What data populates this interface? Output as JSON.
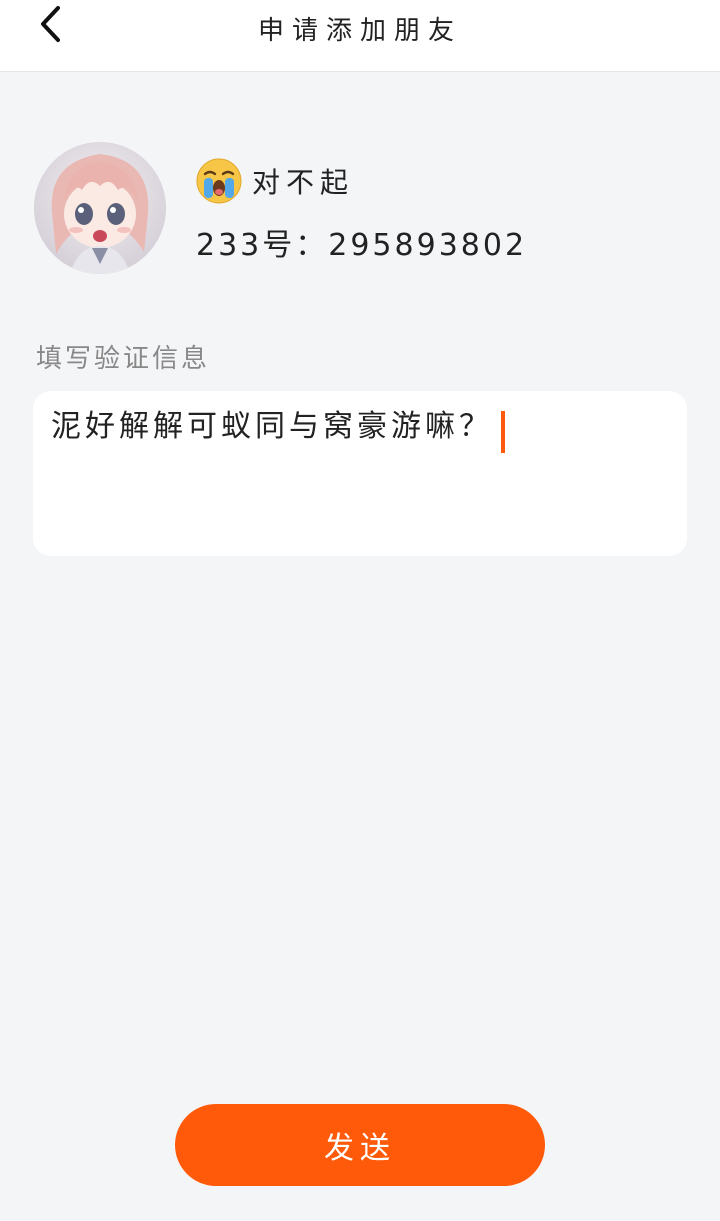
{
  "header": {
    "title": "申请添加朋友",
    "back_icon": "chevron-left-icon"
  },
  "profile": {
    "emoji_icon": "loudly-crying-face-icon",
    "name": "对不起",
    "id_text": "233号：295893802"
  },
  "verification": {
    "label": "填写验证信息",
    "value": "泥好解解可蚁同与窝豪游嘛？"
  },
  "actions": {
    "send_label": "发送"
  },
  "colors": {
    "accent": "#ff5a0a",
    "background": "#f4f5f7",
    "card": "#ffffff",
    "label_gray": "#888888"
  }
}
